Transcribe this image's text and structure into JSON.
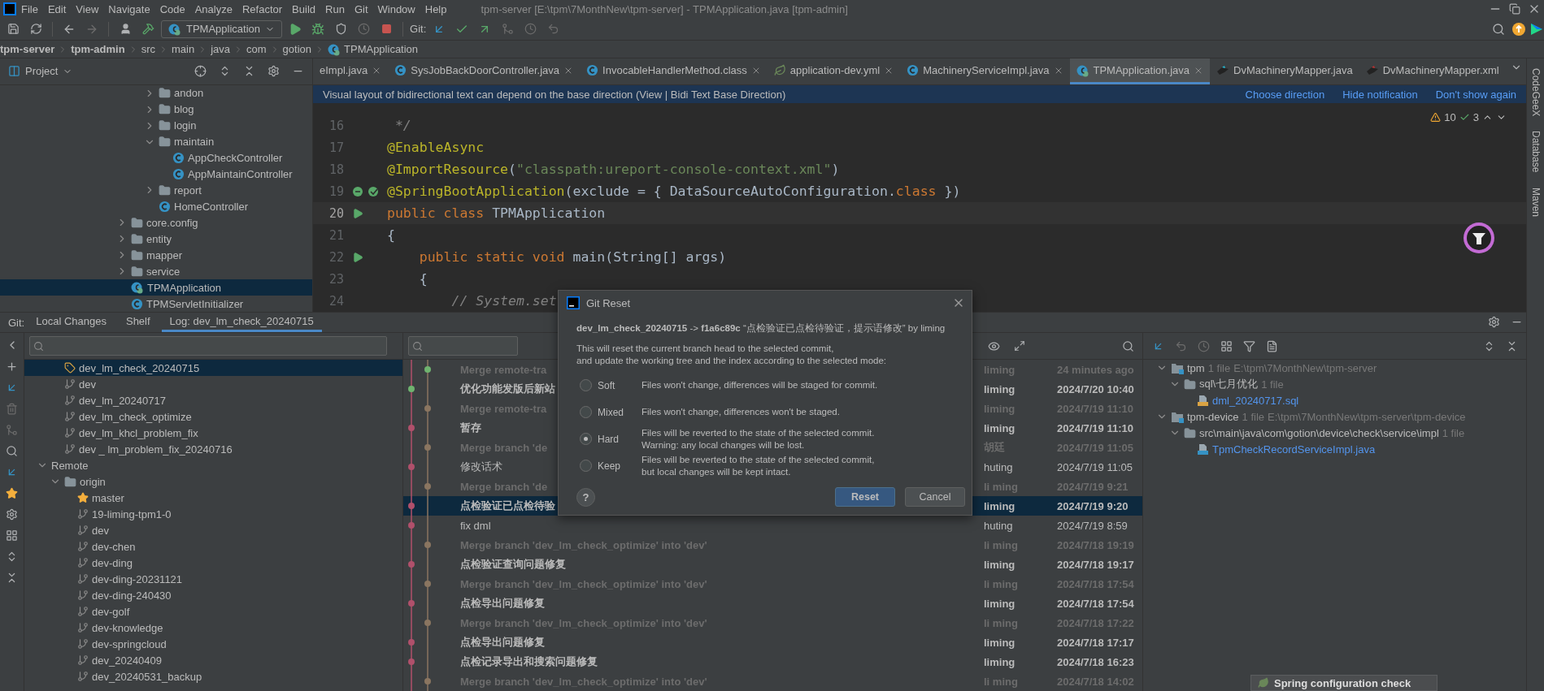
{
  "menu": [
    "File",
    "Edit",
    "View",
    "Navigate",
    "Code",
    "Analyze",
    "Refactor",
    "Build",
    "Run",
    "Git",
    "Window",
    "Help"
  ],
  "window_title": "tpm-server [E:\\tpm\\7MonthNew\\tpm-server] - TPMApplication.java [tpm-admin]",
  "toolbar": {
    "run_config": "TPMApplication",
    "git_label": "Git:"
  },
  "breadcrumbs": [
    {
      "label": "tpm-server",
      "bold": true
    },
    {
      "label": "tpm-admin",
      "bold": true
    },
    {
      "label": "src",
      "bold": false
    },
    {
      "label": "main",
      "bold": false
    },
    {
      "label": "java",
      "bold": false
    },
    {
      "label": "com",
      "bold": false
    },
    {
      "label": "gotion",
      "bold": false
    },
    {
      "label": "TPMApplication",
      "bold": false
    }
  ],
  "project_panel": {
    "title": "Project",
    "tree": [
      {
        "kind": "continued",
        "children": [
          {
            "label": "andon",
            "kind": "folder",
            "expanded": false,
            "selected": false
          },
          {
            "label": "blog",
            "kind": "folder",
            "expanded": false,
            "selected": false
          },
          {
            "label": "login",
            "kind": "folder",
            "expanded": false,
            "selected": false
          },
          {
            "label": "maintain",
            "kind": "folder",
            "expanded": true,
            "selected": false,
            "children": [
              {
                "label": "AppCheckController",
                "kind": "class",
                "selected": false
              },
              {
                "label": "AppMaintainController",
                "kind": "class",
                "selected": false
              }
            ]
          },
          {
            "label": "report",
            "kind": "folder",
            "expanded": false,
            "selected": false
          },
          {
            "label": "HomeController",
            "kind": "class",
            "selected": false
          }
        ]
      },
      {
        "label": "core.config",
        "kind": "folder",
        "expanded": false,
        "selected": false
      },
      {
        "label": "entity",
        "kind": "folder",
        "expanded": false,
        "selected": false
      },
      {
        "label": "mapper",
        "kind": "folder",
        "expanded": false,
        "selected": false
      },
      {
        "label": "service",
        "kind": "folder",
        "expanded": false,
        "selected": false
      },
      {
        "label": "TPMApplication",
        "kind": "app",
        "selected": true
      },
      {
        "label": "TPMServletInitializer",
        "kind": "class",
        "selected": false
      }
    ]
  },
  "editor_tabs": [
    {
      "label": "eImpl.java",
      "selected": false,
      "closable": true
    },
    {
      "label": "SysJobBackDoorController.java",
      "selected": false,
      "closable": true
    },
    {
      "label": "InvocableHandlerMethod.class",
      "selected": false,
      "closable": true
    },
    {
      "label": "application-dev.yml",
      "selected": false,
      "closable": true
    },
    {
      "label": "MachineryServiceImpl.java",
      "selected": false,
      "closable": true
    },
    {
      "label": "TPMApplication.java",
      "selected": true,
      "closable": true
    },
    {
      "label": "DvMachineryMapper.java",
      "selected": false,
      "closable": false
    },
    {
      "label": "DvMachineryMapper.xml",
      "selected": false,
      "closable": false
    }
  ],
  "notification": {
    "text": "Visual layout of bidirectional text can depend on the base direction (View | Bidi Text Base Direction)",
    "actions": [
      "Choose direction",
      "Hide notification",
      "Don't show again"
    ]
  },
  "inspections": {
    "warnings": "10",
    "checks": "3"
  },
  "code_lines": [
    {
      "number": "16",
      "current": false,
      "kind": "plain",
      "tokens": [
        {
          "text": " */",
          "kind": "comment"
        }
      ]
    },
    {
      "number": "17",
      "current": false,
      "kind": "plain",
      "tokens": [
        {
          "text": "@EnableAsync",
          "kind": "annotation"
        }
      ]
    },
    {
      "number": "18",
      "current": false,
      "kind": "plain",
      "tokens": [
        {
          "text": "@ImportResource",
          "kind": "annotation"
        },
        {
          "text": "(",
          "kind": "plain"
        },
        {
          "text": "\"classpath:ureport-console-context.xml\"",
          "kind": "string"
        },
        {
          "text": ")",
          "kind": "plain"
        }
      ]
    },
    {
      "number": "19",
      "current": false,
      "kind": "bean",
      "tokens": [
        {
          "text": "@SpringBootApplication",
          "kind": "annotation"
        },
        {
          "text": "(exclude = { DataSourceAutoConfiguration.",
          "kind": "plain"
        },
        {
          "text": "class",
          "kind": "keyword"
        },
        {
          "text": " })",
          "kind": "plain"
        }
      ]
    },
    {
      "number": "20",
      "current": true,
      "kind": "runnable",
      "tokens": [
        {
          "text": "public class ",
          "kind": "keyword"
        },
        {
          "text": "TPMApplication",
          "kind": "plain"
        }
      ]
    },
    {
      "number": "21",
      "current": false,
      "kind": "plain",
      "tokens": [
        {
          "text": "{",
          "kind": "plain"
        }
      ]
    },
    {
      "number": "22",
      "current": false,
      "kind": "runnable",
      "tokens": [
        {
          "text": "    public static void ",
          "kind": "keyword"
        },
        {
          "text": "main(String[] args)",
          "kind": "plain"
        }
      ]
    },
    {
      "number": "23",
      "current": false,
      "kind": "plain",
      "tokens": [
        {
          "text": "    {",
          "kind": "plain"
        }
      ]
    },
    {
      "number": "24",
      "current": false,
      "kind": "plain",
      "tokens": [
        {
          "text": "        // System.set",
          "kind": "comment"
        }
      ]
    }
  ],
  "tool_strip": [
    "CodeGeeX",
    "Database",
    "Maven"
  ],
  "bottom_tabs": {
    "label": "Git:",
    "tabs": [
      {
        "label": "Local Changes",
        "selected": false
      },
      {
        "label": "Shelf",
        "selected": false
      },
      {
        "label": "Log: dev_lm_check_20240715",
        "selected": true
      }
    ]
  },
  "branches": [
    {
      "kind": "continued",
      "children": [
        {
          "label": "dev_lm_check_20240715",
          "kind": "current",
          "selected": true
        },
        {
          "label": "dev",
          "kind": "branch",
          "selected": false
        },
        {
          "label": "dev_lm_20240717",
          "kind": "branch",
          "selected": false
        },
        {
          "label": "dev_lm_check_optimize",
          "kind": "branch",
          "selected": false
        },
        {
          "label": "dev_lm_khcl_problem_fix",
          "kind": "branch",
          "selected": false
        },
        {
          "label": "dev _ lm_problem_fix_20240716",
          "kind": "branch",
          "selected": false
        }
      ]
    },
    {
      "label": "Remote",
      "kind": "group",
      "expanded": true,
      "selected": false,
      "children": [
        {
          "label": "origin",
          "kind": "folder",
          "expanded": true,
          "selected": false,
          "children": [
            {
              "label": "master",
              "kind": "favorite",
              "selected": false
            },
            {
              "label": "19-liming-tpm1-0",
              "kind": "branch",
              "selected": false
            },
            {
              "label": "dev",
              "kind": "branch",
              "selected": false
            },
            {
              "label": "dev-chen",
              "kind": "branch",
              "selected": false
            },
            {
              "label": "dev-ding",
              "kind": "branch",
              "selected": false
            },
            {
              "label": "dev-ding-20231121",
              "kind": "branch",
              "selected": false
            },
            {
              "label": "dev-ding-240430",
              "kind": "branch",
              "selected": false
            },
            {
              "label": "dev-golf",
              "kind": "branch",
              "selected": false
            },
            {
              "label": "dev-knowledge",
              "kind": "branch",
              "selected": false
            },
            {
              "label": "dev-springcloud",
              "kind": "branch",
              "selected": false
            },
            {
              "label": "dev_20240409",
              "kind": "branch",
              "selected": false
            },
            {
              "label": "dev_20240531_backup",
              "kind": "branch",
              "selected": false
            }
          ]
        }
      ]
    }
  ],
  "commits": [
    {
      "subject": "Merge remote-tra",
      "author": "liming",
      "date": "24 minutes ago",
      "kind": "merge",
      "selected": false
    },
    {
      "subject": "优化功能发版后新站",
      "author": "liming",
      "date": "2024/7/20 10:40",
      "kind": "own",
      "selected": false
    },
    {
      "subject": "Merge remote-tra",
      "author": "liming",
      "date": "2024/7/19 11:10",
      "kind": "merge",
      "selected": false
    },
    {
      "subject": "暂存",
      "author": "liming",
      "date": "2024/7/19 11:10",
      "kind": "own",
      "selected": false
    },
    {
      "subject": "Merge branch 'de",
      "author": "胡廷",
      "date": "2024/7/19 11:05",
      "kind": "merge",
      "selected": false
    },
    {
      "subject": "修改话术",
      "author": "huting",
      "date": "2024/7/19 11:05",
      "kind": "other",
      "selected": false
    },
    {
      "subject": "Merge branch 'de",
      "author": "li ming",
      "date": "2024/7/19 9:21",
      "kind": "merge",
      "selected": false
    },
    {
      "subject": "点检验证已点检待验",
      "author": "liming",
      "date": "2024/7/19 9:20",
      "kind": "own",
      "selected": true
    },
    {
      "subject": "fix dml",
      "author": "huting",
      "date": "2024/7/19 8:59",
      "kind": "other",
      "selected": false
    },
    {
      "subject": "Merge branch 'dev_lm_check_optimize' into 'dev'",
      "author": "li ming",
      "date": "2024/7/18 19:19",
      "kind": "merge",
      "selected": false
    },
    {
      "subject": "点检验证查询问题修复",
      "author": "liming",
      "date": "2024/7/18 19:17",
      "kind": "own",
      "selected": false
    },
    {
      "subject": "Merge branch 'dev_lm_check_optimize' into 'dev'",
      "author": "li ming",
      "date": "2024/7/18 17:54",
      "kind": "merge",
      "selected": false
    },
    {
      "subject": "点检导出问题修复",
      "author": "liming",
      "date": "2024/7/18 17:54",
      "kind": "own",
      "selected": false
    },
    {
      "subject": "Merge branch 'dev_lm_check_optimize' into 'dev'",
      "author": "li ming",
      "date": "2024/7/18 17:22",
      "kind": "merge",
      "selected": false
    },
    {
      "subject": "点检导出问题修复",
      "author": "liming",
      "date": "2024/7/18 17:17",
      "kind": "own",
      "selected": false
    },
    {
      "subject": "点检记录导出和搜索问题修复",
      "author": "liming",
      "date": "2024/7/18 16:23",
      "kind": "own",
      "selected": false
    },
    {
      "subject": "Merge branch 'dev_lm_check_optimize' into 'dev'",
      "author": "li ming",
      "date": "2024/7/18 14:02",
      "kind": "merge",
      "selected": false
    }
  ],
  "changes": [
    {
      "label": "tpm",
      "kind": "module",
      "count": "1 file",
      "path": "E:\\tpm\\7MonthNew\\tpm-server",
      "expanded": true,
      "children": [
        {
          "label": "sql\\七月优化",
          "kind": "folder",
          "count": "1 file",
          "expanded": true,
          "children": [
            {
              "label": "dml_20240717.sql",
              "kind": "sql"
            }
          ]
        }
      ]
    },
    {
      "label": "tpm-device",
      "kind": "module",
      "count": "1 file",
      "path": "E:\\tpm\\7MonthNew\\tpm-server\\tpm-device",
      "expanded": true,
      "children": [
        {
          "label": "src\\main\\java\\com\\gotion\\device\\check\\service\\impl",
          "kind": "folder",
          "count": "1 file",
          "expanded": true,
          "children": [
            {
              "label": "TpmCheckRecordServiceImpl.java",
              "kind": "java"
            }
          ]
        }
      ]
    }
  ],
  "dialog": {
    "title": "Git Reset",
    "header": "**dev_lm_check_20240715** -> **f1a6c89c** “点检验证已点检待验证，提示语修改” by liming",
    "description": [
      "This will reset the current branch head to the selected commit,",
      "and update the working tree and the index according to the selected mode:"
    ],
    "modes": [
      {
        "label": "Soft",
        "selected": false,
        "lines": [
          "Files won't change, differences will be staged for commit."
        ]
      },
      {
        "label": "Mixed",
        "selected": false,
        "lines": [
          "Files won't change, differences won't be staged."
        ]
      },
      {
        "label": "Hard",
        "selected": true,
        "lines": [
          "Files will be reverted to the state of the selected commit.",
          "Warning: any local changes will be lost."
        ]
      },
      {
        "label": "Keep",
        "selected": false,
        "lines": [
          "Files will be reverted to the state of the selected commit,",
          "but local changes will be kept intact."
        ]
      }
    ],
    "help": "?",
    "buttons": [
      {
        "label": "Reset",
        "default": true
      },
      {
        "label": "Cancel",
        "default": false
      }
    ]
  },
  "popup": {
    "text": "Spring configuration check"
  }
}
